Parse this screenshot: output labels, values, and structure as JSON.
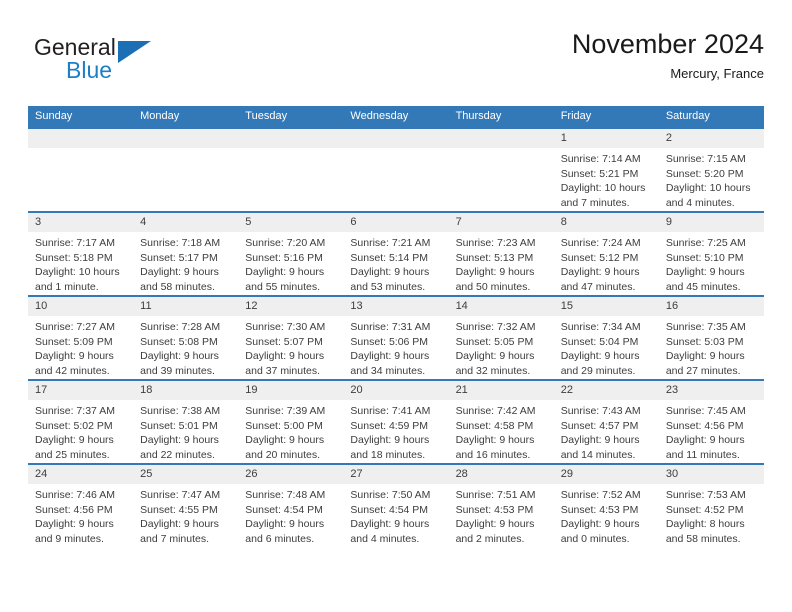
{
  "logo": {
    "word1": "General",
    "word2": "Blue",
    "triangle_color": "#1c6fb5",
    "text_color": "#231f20",
    "blue_text_color": "#1c7fc4"
  },
  "header": {
    "title": "November 2024",
    "subtitle": "Mercury, France"
  },
  "theme": {
    "header_blue": "#3479b7",
    "band_gray": "#efefef",
    "text": "#3d3d3d"
  },
  "calendar": {
    "weekdays": [
      "Sunday",
      "Monday",
      "Tuesday",
      "Wednesday",
      "Thursday",
      "Friday",
      "Saturday"
    ],
    "weeks": [
      [
        {
          "day": "",
          "lines": []
        },
        {
          "day": "",
          "lines": []
        },
        {
          "day": "",
          "lines": []
        },
        {
          "day": "",
          "lines": []
        },
        {
          "day": "",
          "lines": []
        },
        {
          "day": "1",
          "lines": [
            "Sunrise: 7:14 AM",
            "Sunset: 5:21 PM",
            "Daylight: 10 hours",
            "and 7 minutes."
          ]
        },
        {
          "day": "2",
          "lines": [
            "Sunrise: 7:15 AM",
            "Sunset: 5:20 PM",
            "Daylight: 10 hours",
            "and 4 minutes."
          ]
        }
      ],
      [
        {
          "day": "3",
          "lines": [
            "Sunrise: 7:17 AM",
            "Sunset: 5:18 PM",
            "Daylight: 10 hours",
            "and 1 minute."
          ]
        },
        {
          "day": "4",
          "lines": [
            "Sunrise: 7:18 AM",
            "Sunset: 5:17 PM",
            "Daylight: 9 hours",
            "and 58 minutes."
          ]
        },
        {
          "day": "5",
          "lines": [
            "Sunrise: 7:20 AM",
            "Sunset: 5:16 PM",
            "Daylight: 9 hours",
            "and 55 minutes."
          ]
        },
        {
          "day": "6",
          "lines": [
            "Sunrise: 7:21 AM",
            "Sunset: 5:14 PM",
            "Daylight: 9 hours",
            "and 53 minutes."
          ]
        },
        {
          "day": "7",
          "lines": [
            "Sunrise: 7:23 AM",
            "Sunset: 5:13 PM",
            "Daylight: 9 hours",
            "and 50 minutes."
          ]
        },
        {
          "day": "8",
          "lines": [
            "Sunrise: 7:24 AM",
            "Sunset: 5:12 PM",
            "Daylight: 9 hours",
            "and 47 minutes."
          ]
        },
        {
          "day": "9",
          "lines": [
            "Sunrise: 7:25 AM",
            "Sunset: 5:10 PM",
            "Daylight: 9 hours",
            "and 45 minutes."
          ]
        }
      ],
      [
        {
          "day": "10",
          "lines": [
            "Sunrise: 7:27 AM",
            "Sunset: 5:09 PM",
            "Daylight: 9 hours",
            "and 42 minutes."
          ]
        },
        {
          "day": "11",
          "lines": [
            "Sunrise: 7:28 AM",
            "Sunset: 5:08 PM",
            "Daylight: 9 hours",
            "and 39 minutes."
          ]
        },
        {
          "day": "12",
          "lines": [
            "Sunrise: 7:30 AM",
            "Sunset: 5:07 PM",
            "Daylight: 9 hours",
            "and 37 minutes."
          ]
        },
        {
          "day": "13",
          "lines": [
            "Sunrise: 7:31 AM",
            "Sunset: 5:06 PM",
            "Daylight: 9 hours",
            "and 34 minutes."
          ]
        },
        {
          "day": "14",
          "lines": [
            "Sunrise: 7:32 AM",
            "Sunset: 5:05 PM",
            "Daylight: 9 hours",
            "and 32 minutes."
          ]
        },
        {
          "day": "15",
          "lines": [
            "Sunrise: 7:34 AM",
            "Sunset: 5:04 PM",
            "Daylight: 9 hours",
            "and 29 minutes."
          ]
        },
        {
          "day": "16",
          "lines": [
            "Sunrise: 7:35 AM",
            "Sunset: 5:03 PM",
            "Daylight: 9 hours",
            "and 27 minutes."
          ]
        }
      ],
      [
        {
          "day": "17",
          "lines": [
            "Sunrise: 7:37 AM",
            "Sunset: 5:02 PM",
            "Daylight: 9 hours",
            "and 25 minutes."
          ]
        },
        {
          "day": "18",
          "lines": [
            "Sunrise: 7:38 AM",
            "Sunset: 5:01 PM",
            "Daylight: 9 hours",
            "and 22 minutes."
          ]
        },
        {
          "day": "19",
          "lines": [
            "Sunrise: 7:39 AM",
            "Sunset: 5:00 PM",
            "Daylight: 9 hours",
            "and 20 minutes."
          ]
        },
        {
          "day": "20",
          "lines": [
            "Sunrise: 7:41 AM",
            "Sunset: 4:59 PM",
            "Daylight: 9 hours",
            "and 18 minutes."
          ]
        },
        {
          "day": "21",
          "lines": [
            "Sunrise: 7:42 AM",
            "Sunset: 4:58 PM",
            "Daylight: 9 hours",
            "and 16 minutes."
          ]
        },
        {
          "day": "22",
          "lines": [
            "Sunrise: 7:43 AM",
            "Sunset: 4:57 PM",
            "Daylight: 9 hours",
            "and 14 minutes."
          ]
        },
        {
          "day": "23",
          "lines": [
            "Sunrise: 7:45 AM",
            "Sunset: 4:56 PM",
            "Daylight: 9 hours",
            "and 11 minutes."
          ]
        }
      ],
      [
        {
          "day": "24",
          "lines": [
            "Sunrise: 7:46 AM",
            "Sunset: 4:56 PM",
            "Daylight: 9 hours",
            "and 9 minutes."
          ]
        },
        {
          "day": "25",
          "lines": [
            "Sunrise: 7:47 AM",
            "Sunset: 4:55 PM",
            "Daylight: 9 hours",
            "and 7 minutes."
          ]
        },
        {
          "day": "26",
          "lines": [
            "Sunrise: 7:48 AM",
            "Sunset: 4:54 PM",
            "Daylight: 9 hours",
            "and 6 minutes."
          ]
        },
        {
          "day": "27",
          "lines": [
            "Sunrise: 7:50 AM",
            "Sunset: 4:54 PM",
            "Daylight: 9 hours",
            "and 4 minutes."
          ]
        },
        {
          "day": "28",
          "lines": [
            "Sunrise: 7:51 AM",
            "Sunset: 4:53 PM",
            "Daylight: 9 hours",
            "and 2 minutes."
          ]
        },
        {
          "day": "29",
          "lines": [
            "Sunrise: 7:52 AM",
            "Sunset: 4:53 PM",
            "Daylight: 9 hours",
            "and 0 minutes."
          ]
        },
        {
          "day": "30",
          "lines": [
            "Sunrise: 7:53 AM",
            "Sunset: 4:52 PM",
            "Daylight: 8 hours",
            "and 58 minutes."
          ]
        }
      ]
    ]
  }
}
